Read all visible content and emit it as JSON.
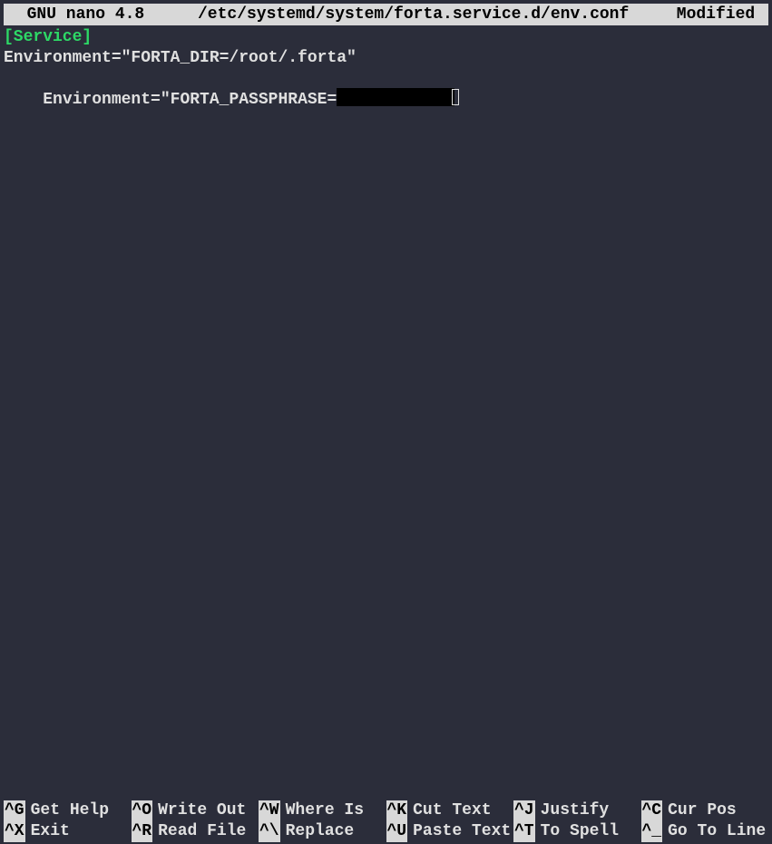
{
  "titlebar": {
    "app_name": "  GNU nano 4.8",
    "file_path": "/etc/systemd/system/forta.service.d/env.conf",
    "status": "Modified "
  },
  "content": {
    "section": "[Service]",
    "line1": "Environment=\"FORTA_DIR=/root/.forta\"",
    "line2_prefix": "Environment=\"FORTA_PASSPHRASE="
  },
  "shortcuts": {
    "row1": [
      {
        "key": "^G",
        "label": "Get Help"
      },
      {
        "key": "^O",
        "label": "Write Out"
      },
      {
        "key": "^W",
        "label": "Where Is"
      },
      {
        "key": "^K",
        "label": "Cut Text"
      },
      {
        "key": "^J",
        "label": "Justify"
      },
      {
        "key": "^C",
        "label": "Cur Pos"
      }
    ],
    "row2": [
      {
        "key": "^X",
        "label": "Exit"
      },
      {
        "key": "^R",
        "label": "Read File"
      },
      {
        "key": "^\\",
        "label": "Replace"
      },
      {
        "key": "^U",
        "label": "Paste Text"
      },
      {
        "key": "^T",
        "label": "To Spell"
      },
      {
        "key": "^_",
        "label": "Go To Line"
      }
    ]
  }
}
